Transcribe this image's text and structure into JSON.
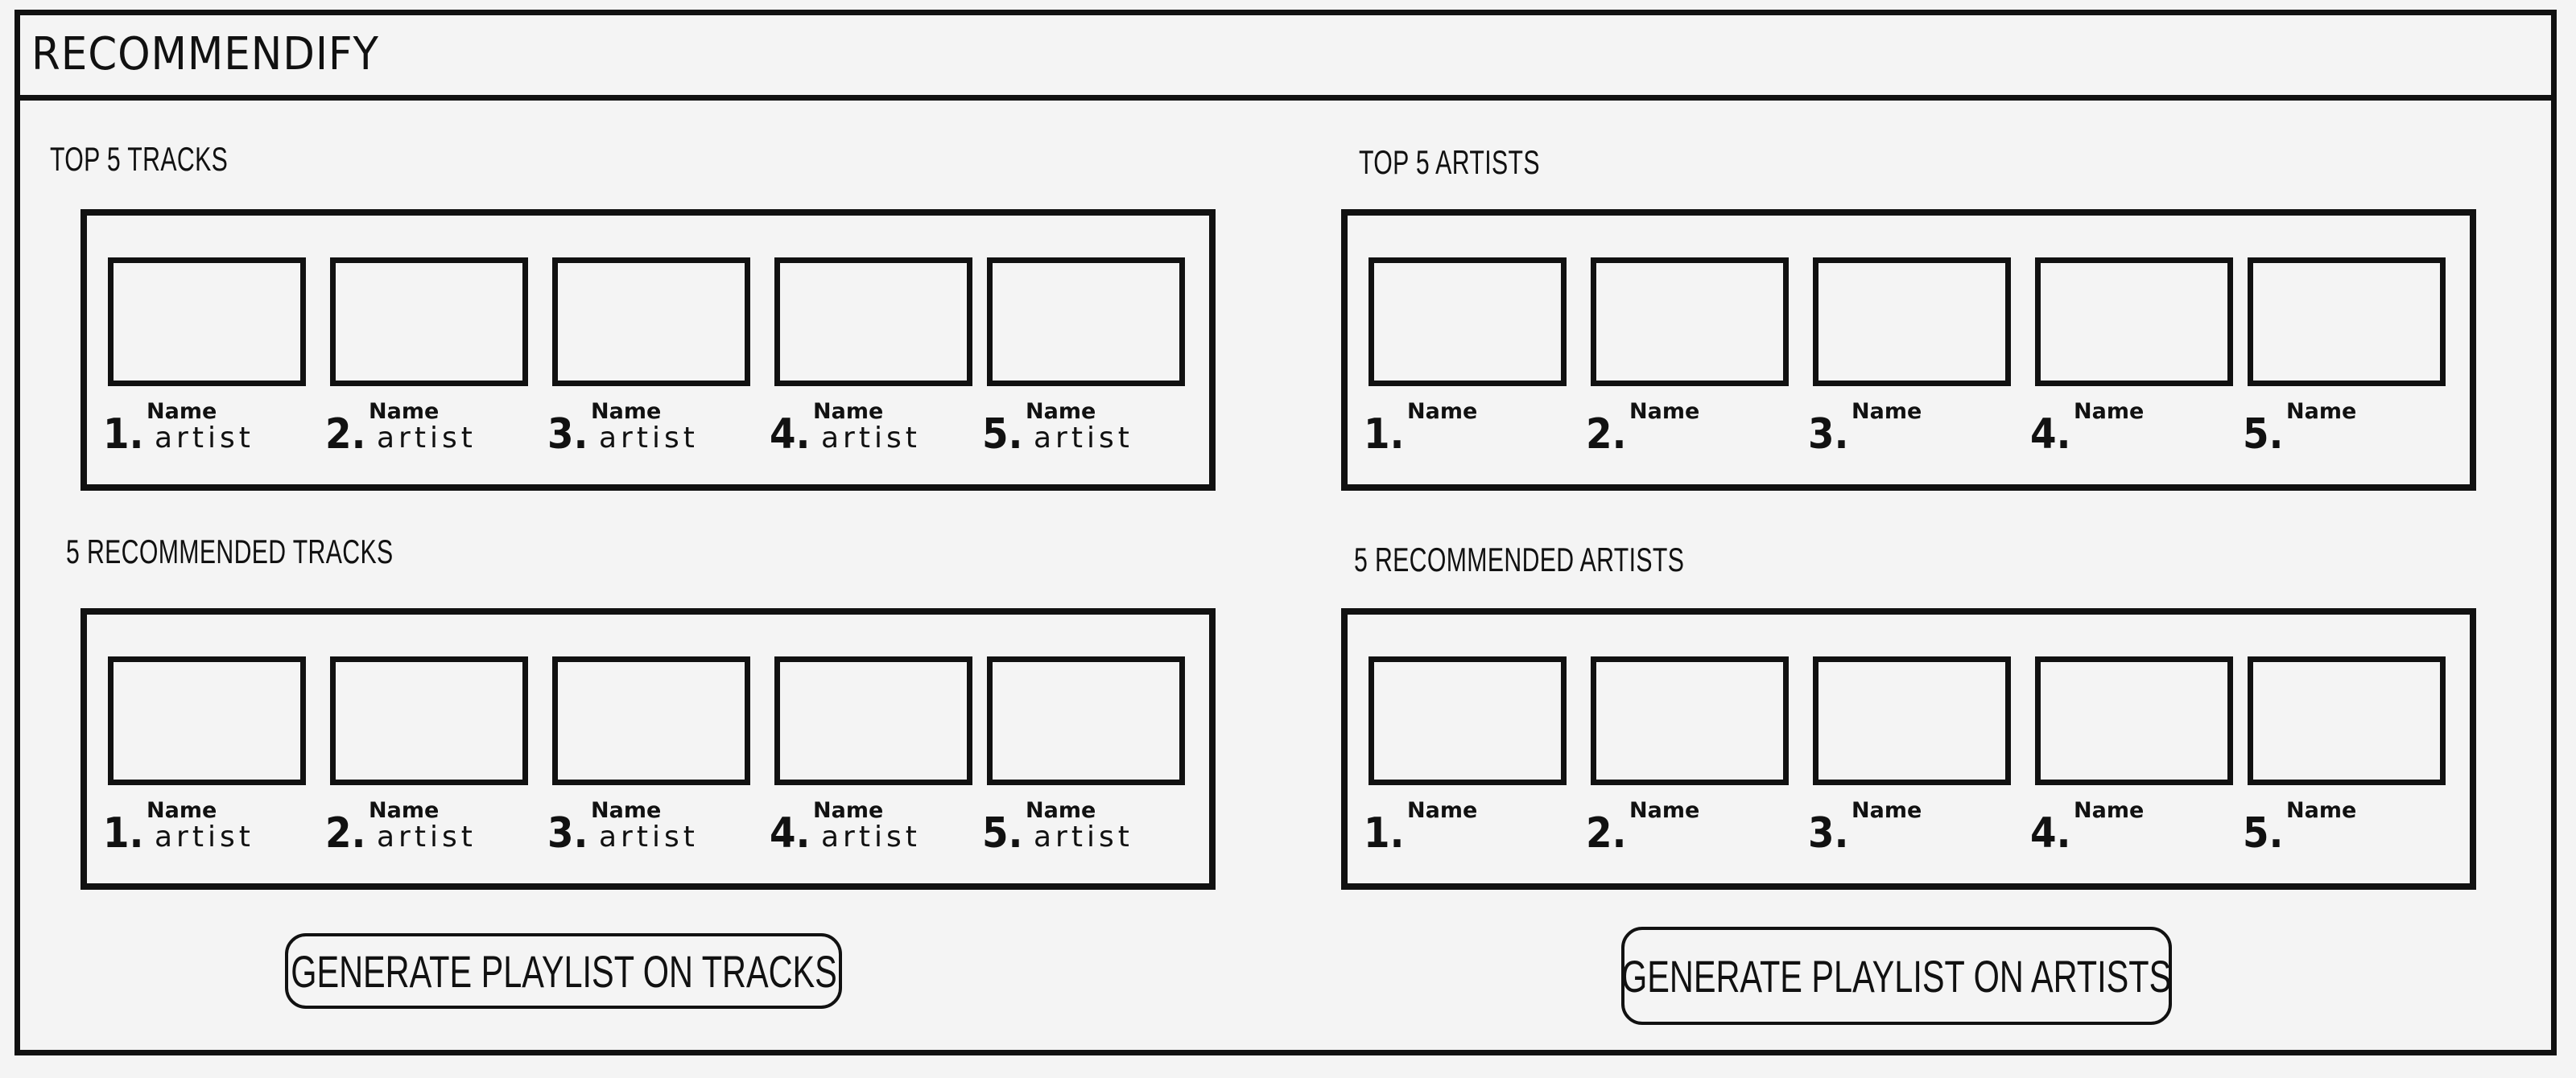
{
  "app": {
    "title": "RECOMMENDIFY"
  },
  "sections": {
    "top_tracks": {
      "label": "TOP 5 TRACKS",
      "items": [
        {
          "rank": "1.",
          "name": "Name",
          "artist": "artist"
        },
        {
          "rank": "2.",
          "name": "Name",
          "artist": "artist"
        },
        {
          "rank": "3.",
          "name": "Name",
          "artist": "artist"
        },
        {
          "rank": "4.",
          "name": "Name",
          "artist": "artist"
        },
        {
          "rank": "5.",
          "name": "Name",
          "artist": "artist"
        }
      ]
    },
    "top_artists": {
      "label": "TOP 5 ARTISTS",
      "items": [
        {
          "rank": "1.",
          "name": "Name"
        },
        {
          "rank": "2.",
          "name": "Name"
        },
        {
          "rank": "3.",
          "name": "Name"
        },
        {
          "rank": "4.",
          "name": "Name"
        },
        {
          "rank": "5.",
          "name": "Name"
        }
      ]
    },
    "recommended_tracks": {
      "label": "5 RECOMMENDED TRACKS",
      "items": [
        {
          "rank": "1.",
          "name": "Name",
          "artist": "artist"
        },
        {
          "rank": "2.",
          "name": "Name",
          "artist": "artist"
        },
        {
          "rank": "3.",
          "name": "Name",
          "artist": "artist"
        },
        {
          "rank": "4.",
          "name": "Name",
          "artist": "artist"
        },
        {
          "rank": "5.",
          "name": "Name",
          "artist": "artist"
        }
      ]
    },
    "recommended_artists": {
      "label": "5 RECOMMENDED ARTISTS",
      "items": [
        {
          "rank": "1.",
          "name": "Name"
        },
        {
          "rank": "2.",
          "name": "Name"
        },
        {
          "rank": "3.",
          "name": "Name"
        },
        {
          "rank": "4.",
          "name": "Name"
        },
        {
          "rank": "5.",
          "name": "Name"
        }
      ]
    }
  },
  "buttons": {
    "tracks_label": "GENERATE PLAYLIST ON TRACKS",
    "artists_label": "GENERATE PLAYLIST ON ARTISTS"
  }
}
